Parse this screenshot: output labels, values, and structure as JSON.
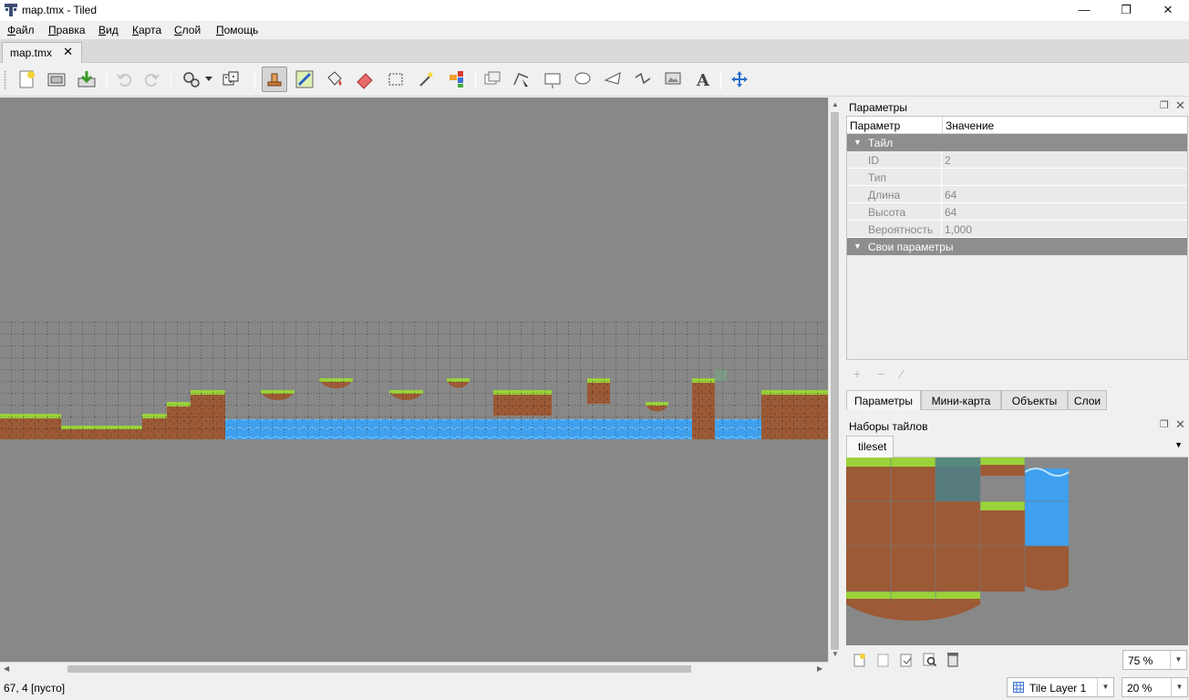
{
  "window": {
    "title": "map.tmx - Tiled",
    "minimize_glyph": "—",
    "maximize_glyph": "❐",
    "close_glyph": "✕"
  },
  "menu": [
    {
      "underlined": "Ф",
      "rest": "айл"
    },
    {
      "underlined": "П",
      "rest": "равка"
    },
    {
      "underlined": "В",
      "rest": "ид"
    },
    {
      "underlined": "К",
      "rest": "арта"
    },
    {
      "underlined": "С",
      "rest": "лой"
    },
    {
      "underlined": "П",
      "rest": "омощь"
    }
  ],
  "document_tab": {
    "label": "map.tmx",
    "close": "✕"
  },
  "toolbar": {
    "icons": [
      "new-map",
      "open",
      "save",
      "undo",
      "redo",
      "commands",
      "random",
      "stamp-brush",
      "terrain-brush",
      "bucket-fill",
      "eraser",
      "rect-select",
      "magic-wand",
      "select-same-tile",
      "select-objects",
      "edit-polygons",
      "insert-rectangle",
      "insert-ellipse",
      "insert-polygon",
      "insert-polyline",
      "insert-tile",
      "insert-text",
      "move"
    ],
    "active_tool": "stamp-brush"
  },
  "colors": {
    "canvas_bg": "#888888",
    "grass": "#9bd23a",
    "dirt": "#9c5a36",
    "water": "#3ea0ee",
    "accent_move": "#2b6fd0"
  },
  "properties_panel": {
    "title": "Параметры",
    "col_param": "Параметр",
    "col_value": "Значение",
    "group_tile": "Тайл",
    "rows": [
      {
        "key": "ID",
        "value": "2"
      },
      {
        "key": "Тип",
        "value": ""
      },
      {
        "key": "Длина",
        "value": "64"
      },
      {
        "key": "Высота",
        "value": "64"
      },
      {
        "key": "Вероятность",
        "value": "1,000"
      }
    ],
    "group_custom": "Свои параметры",
    "add": "+",
    "remove": "−",
    "rename": "⁄"
  },
  "dock_tabs": [
    "Параметры",
    "Мини-карта",
    "Объекты",
    "Слои"
  ],
  "tilesets_panel": {
    "title": "Наборы тайлов",
    "tab": "tileset",
    "dropdown": "▼",
    "zoom": "75 %"
  },
  "statusbar": {
    "coords": "67, 4 [пусто]",
    "layer": "Tile Layer 1",
    "zoom": "20 %"
  }
}
